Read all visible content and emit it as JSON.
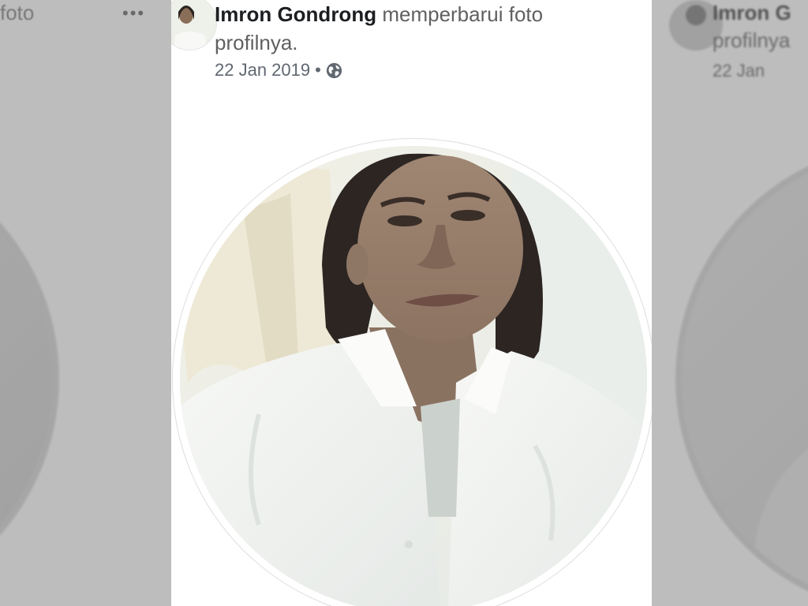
{
  "post": {
    "author_name": "Imron Gondrong",
    "action_text": "memperbarui foto profilnya.",
    "date": "22 Jan 2019",
    "separator": "•",
    "privacy_icon": "globe-icon"
  },
  "side_left": {
    "text_fragment": "foto",
    "menu_label": "•••"
  },
  "side_right": {
    "author_fragment": "Imron G",
    "action_fragment": "profilnya",
    "date_fragment": "22 Jan"
  },
  "colors": {
    "card_background": "#ffffff",
    "author_text": "#1c1e21",
    "secondary_text": "#606770",
    "overlay_gray": "#bdbdbd"
  }
}
